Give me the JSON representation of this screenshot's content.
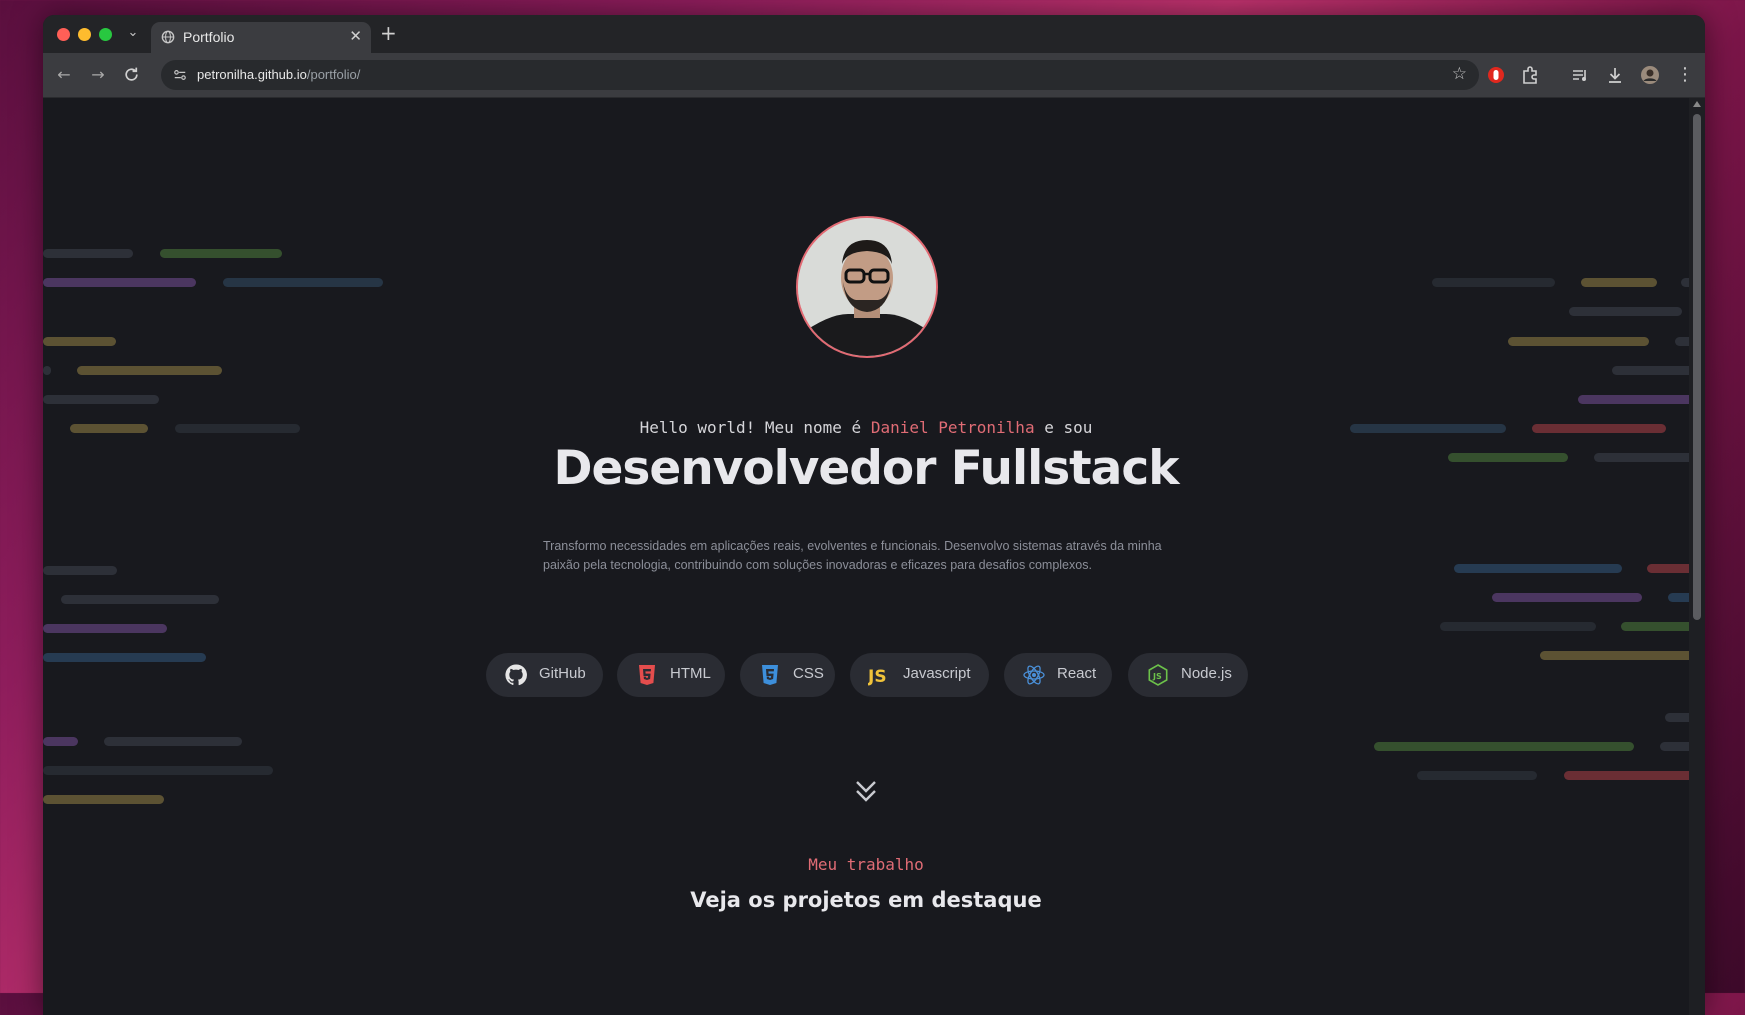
{
  "browser": {
    "tab_title": "Portfolio",
    "url_host": "petronilha.github.io",
    "url_path": "/portfolio/"
  },
  "hero": {
    "greeting_prefix": "Hello world! Meu nome é ",
    "greeting_name": "Daniel Petronilha",
    "greeting_suffix": " e sou",
    "headline": "Desenvolvedor Fullstack",
    "description": "Transformo necessidades em aplicações reais, evolventes e funcionais. Desenvolvo sistemas através da minha paixão pela tecnologia, contribuindo com soluções inovadoras e eficazes para desafios complexos."
  },
  "skills": [
    {
      "label": "GitHub",
      "icon": "github-icon"
    },
    {
      "label": "HTML",
      "icon": "html5-icon"
    },
    {
      "label": "CSS",
      "icon": "css3-icon"
    },
    {
      "label": "Javascript",
      "icon": "javascript-icon"
    },
    {
      "label": "React",
      "icon": "react-icon"
    },
    {
      "label": "Node.js",
      "icon": "nodejs-icon"
    }
  ],
  "section": {
    "kicker": "Meu trabalho",
    "title": "Veja os projetos em destaque"
  },
  "colors": {
    "accent": "#e06c75",
    "background": "#18191e",
    "chip_bg": "#2a2c33"
  }
}
